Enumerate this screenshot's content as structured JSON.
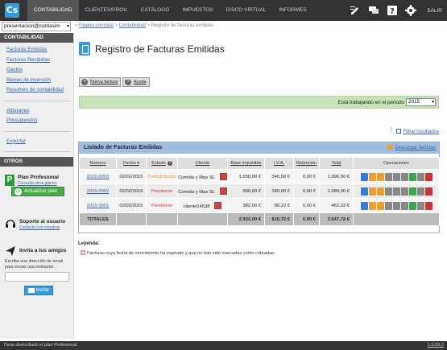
{
  "app": {
    "logo": "Cs"
  },
  "nav": [
    {
      "label": "Contabilidad",
      "active": true
    },
    {
      "label": "Clientes/Prov.",
      "active": false
    },
    {
      "label": "Catálogo",
      "active": false
    },
    {
      "label": "Impuestos",
      "active": false
    },
    {
      "label": "Disco Virtual",
      "active": false
    },
    {
      "label": "Informes",
      "active": false
    }
  ],
  "topbar": {
    "salir": "SALIR",
    "icons": [
      "edit-icon",
      "chat-icon",
      "help-icon",
      "gear-icon"
    ]
  },
  "user_select": "presentacion@contasim",
  "breadcrumb": {
    "items": [
      "Página principal",
      "Contabilidad"
    ],
    "current": "Registro de facturas emitidas",
    "sep": " > "
  },
  "sidebar": {
    "heading_conta": "CONTABILIDAD",
    "links_a": [
      "Facturas Emitidas",
      "Facturas Recibidas",
      "Gastos",
      "Bienes de inversión",
      "Resumen de contabilidad"
    ],
    "links_b": [
      "Albaranes",
      "Presupuestos"
    ],
    "links_c": [
      "Exportar"
    ],
    "heading_otros": "OTROS",
    "plan": {
      "badge": "P",
      "title": "Plan Profesional",
      "sub": "Consulta otros planes",
      "button": "Actualizar plan"
    },
    "support": {
      "title": "Soporte al usuario",
      "sub": "Contacta con nosotros"
    },
    "invite": {
      "title": "Invita a tus amigos",
      "text": "Escribe una dirección de email para enviar una invitación:",
      "input_value": "",
      "button": "Invitar"
    }
  },
  "page": {
    "title": "Registro de Facturas Emitidas",
    "btn_new": "Nueva factura",
    "btn_help": "Ayuda",
    "period_label": "Está trabajando en el periodo",
    "period_value": "2015",
    "filtrar": "Filtrar resultados"
  },
  "list": {
    "title": "Listado de Facturas Emitidas",
    "download": "Descargar facturas",
    "headers": [
      "Número",
      "Fecha ▾",
      "Estado",
      "Cliente",
      "Base imponible",
      "I.V.A.",
      "Retención",
      "Total",
      "Operaciones"
    ],
    "rows": [
      {
        "numero": "2015-0003",
        "fecha": "02/02/2015",
        "estado": "Contabilizada",
        "estado_type": "contab",
        "cliente": "Comida y Mas SL",
        "base": "1.650,00 €",
        "iva": "346,50 €",
        "ret": "0,00 €",
        "total": "1.996,50 €"
      },
      {
        "numero": "2015-0002",
        "fecha": "02/02/2015",
        "estado": "Pendiente",
        "estado_type": "pend",
        "cliente": "Comida y Mas SL",
        "base": "900,00 €",
        "iva": "189,00 €",
        "ret": "0,00 €",
        "total": "1.089,00 €"
      },
      {
        "numero": "2015-0001",
        "fecha": "02/02/2015",
        "estado": "Pendiente",
        "estado_type": "pend",
        "cliente": "cliente14538",
        "base": "382,00 €",
        "iva": "80,22 €",
        "ret": "0,00 €",
        "total": "462,22 €"
      }
    ],
    "totals": {
      "label": "TOTALES",
      "base": "2.932,00 €",
      "iva": "615,72 €",
      "ret": "0,00 €",
      "total": "3.547,72 €"
    },
    "ops_icons": [
      {
        "name": "edit-op-icon",
        "color": "#3a7ad9"
      },
      {
        "name": "copy-op-icon",
        "color": "#e8a030"
      },
      {
        "name": "view-op-icon",
        "color": "#e8a030"
      },
      {
        "name": "print-op-icon",
        "color": "#888888"
      },
      {
        "name": "pdf-op-icon",
        "color": "#888888"
      },
      {
        "name": "mail-op-icon",
        "color": "#888888"
      },
      {
        "name": "charge-op-icon",
        "color": "#3aa84a"
      },
      {
        "name": "envelope-op-icon",
        "color": "#888888"
      },
      {
        "name": "delete-op-icon",
        "color": "#cc3333"
      }
    ]
  },
  "legend": {
    "title": "Leyenda:",
    "text": "Facturas cuya fecha de vencimiento ha expirado y que no han sido marcadas como cobradas."
  },
  "footer": {
    "text": "Tiene domiciliado el plan Profesional.",
    "version": "1.0.56.0"
  }
}
